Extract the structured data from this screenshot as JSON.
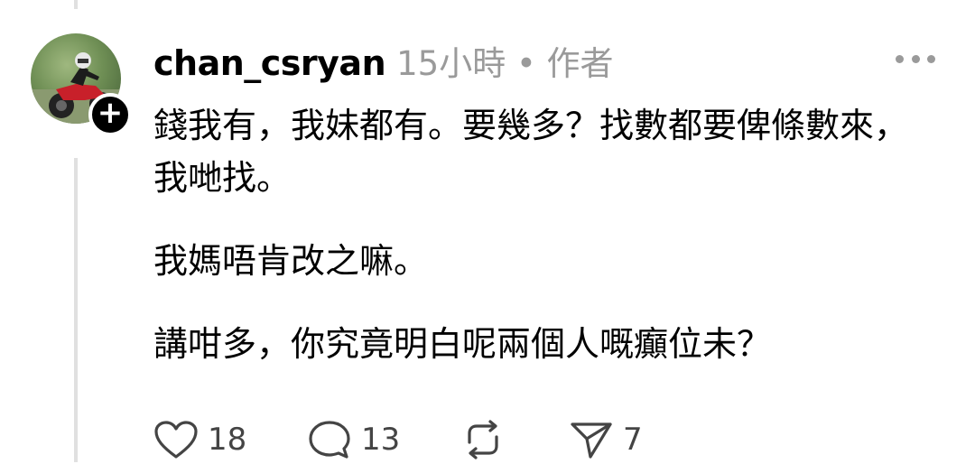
{
  "post": {
    "username": "chan_csryan",
    "meta": "15小時 • 作者",
    "paragraphs": [
      "錢我有，我妹都有。要幾多？找數都要俾條數來，我哋找。",
      "我媽唔肯改之嘛。",
      "講咁多，你究竟明白呢兩個人嘅癲位未？"
    ],
    "stats": {
      "likes": "18",
      "comments": "13",
      "shares": "7"
    }
  },
  "icons": {
    "avatar": "avatar-motorcycle-rider",
    "follow": "plus-icon",
    "more": "more-dots-icon",
    "like": "heart-icon",
    "comment": "comment-bubble-icon",
    "repost": "repost-icon",
    "share": "send-icon"
  }
}
